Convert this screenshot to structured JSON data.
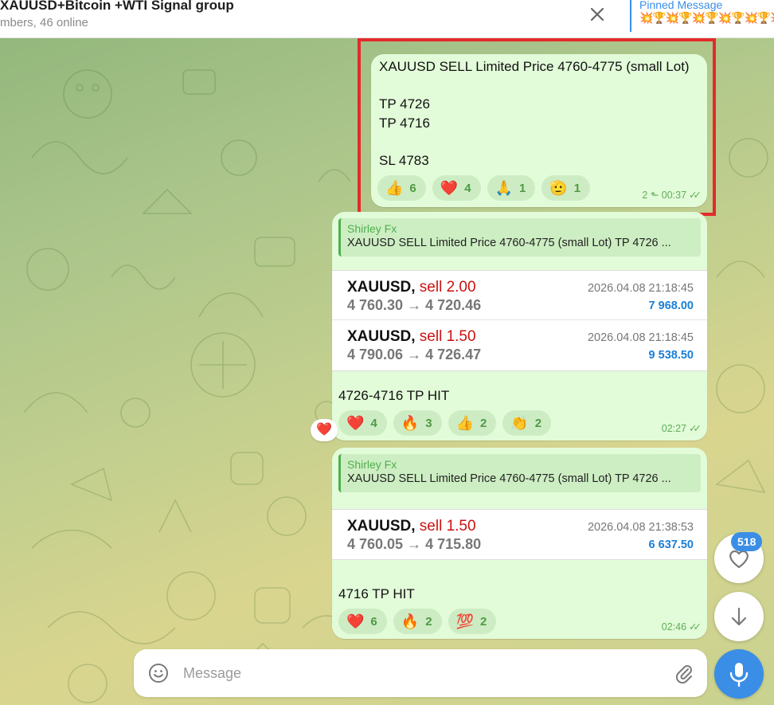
{
  "header": {
    "title": "XAUUSD+Bitcoin +WTI Signal group",
    "subtitle": "mbers, 46 online",
    "pinned_label": "Pinned Message",
    "pinned_text": "💥🏆💥🏆💥🏆💥🏆💥🏆💥🏆"
  },
  "messages": [
    {
      "text": "XAUUSD SELL Limited Price 4760-4775 (small Lot)\n\nTP 4726\nTP 4716\n\nSL 4783",
      "reactions": [
        {
          "emoji": "👍",
          "count": "6"
        },
        {
          "emoji": "❤️",
          "count": "4"
        },
        {
          "emoji": "🙏",
          "count": "1"
        },
        {
          "emoji": "🫡",
          "count": "1"
        }
      ],
      "replies": "2",
      "time": "00:37"
    },
    {
      "quote_name": "Shirley Fx",
      "quote_text": "XAUUSD SELL Limited Price 4760-4775 (small Lot) TP 4726 ...",
      "trades": [
        {
          "symbol": "XAUUSD,",
          "side": "sell 2.00",
          "prices": "4 760.30 → 4 720.46",
          "date": "2026.04.08 21:18:45",
          "profit": "7 968.00"
        },
        {
          "symbol": "XAUUSD,",
          "side": "sell 1.50",
          "prices": "4 790.06 → 4 726.47",
          "date": "2026.04.08 21:18:45",
          "profit": "9 538.50"
        }
      ],
      "text": "4726-4716 TP HIT",
      "reactions": [
        {
          "emoji": "❤️",
          "count": "4"
        },
        {
          "emoji": "🔥",
          "count": "3"
        },
        {
          "emoji": "👍",
          "count": "2"
        },
        {
          "emoji": "👏",
          "count": "2"
        }
      ],
      "time": "02:27",
      "side_reaction": "❤️"
    },
    {
      "quote_name": "Shirley Fx",
      "quote_text": "XAUUSD SELL Limited Price 4760-4775 (small Lot) TP 4726 ...",
      "trades": [
        {
          "symbol": "XAUUSD,",
          "side": "sell 1.50",
          "prices": "4 760.05 → 4 715.80",
          "date": "2026.04.08 21:38:53",
          "profit": "6 637.50"
        }
      ],
      "text": "4716 TP HIT",
      "reactions": [
        {
          "emoji": "❤️",
          "count": "6"
        },
        {
          "emoji": "🔥",
          "count": "2"
        },
        {
          "emoji": "💯",
          "count": "2"
        }
      ],
      "time": "02:46"
    }
  ],
  "reactions_badge": "518",
  "composer": {
    "placeholder": "Message"
  },
  "icons": {
    "close": "close-icon",
    "emoji": "smiley-icon",
    "attach": "paperclip-icon",
    "mic": "microphone-icon",
    "heart": "heart-icon",
    "scroll": "arrow-down-icon"
  },
  "colors": {
    "accent": "#3a8ee6",
    "bubble": "#e2fbd9",
    "highlight": "#e32b2b",
    "sell": "#cc1111",
    "profit": "#1a7fd6"
  }
}
